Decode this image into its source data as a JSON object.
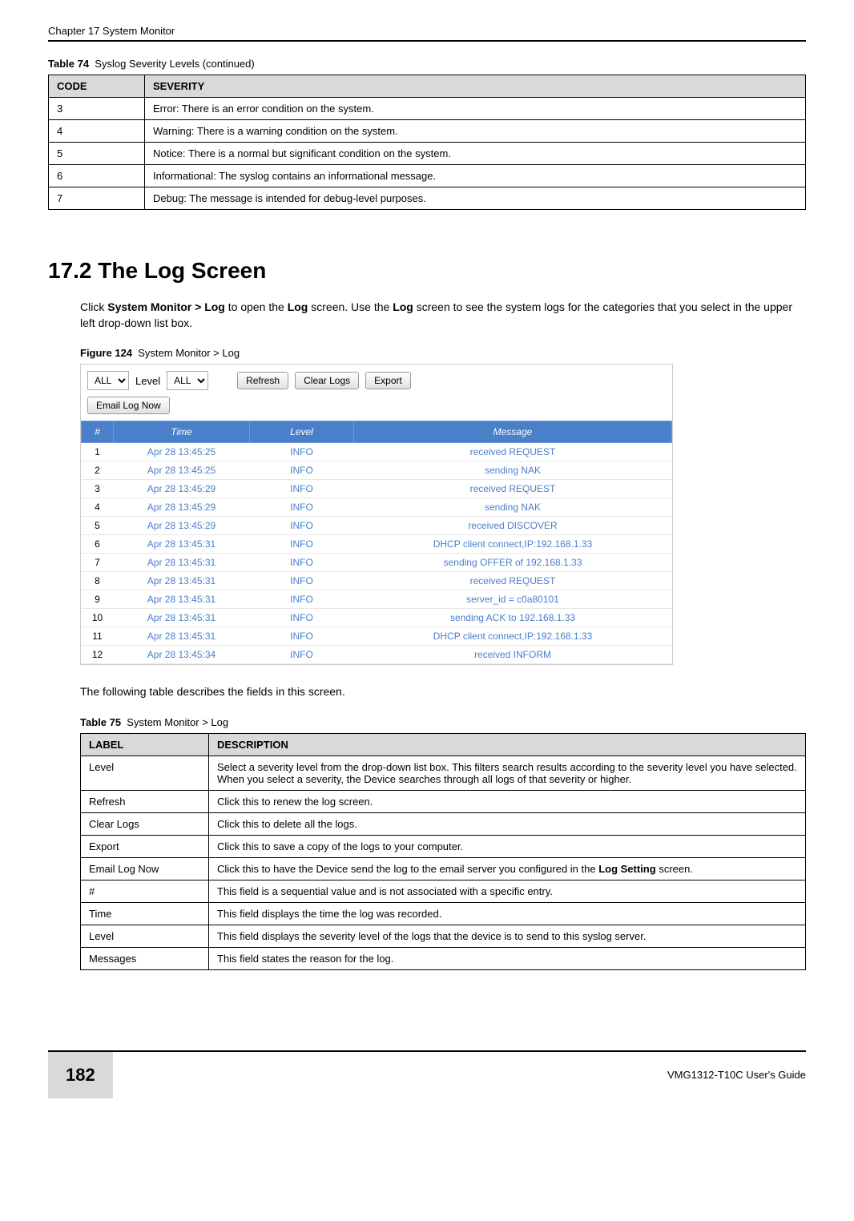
{
  "header": {
    "chapter": "Chapter 17 System Monitor"
  },
  "table74": {
    "title_label": "Table 74",
    "title": "Syslog Severity Levels (continued)",
    "headers": {
      "code": "CODE",
      "severity": "SEVERITY"
    },
    "rows": [
      {
        "code": "3",
        "severity": "Error: There is an error condition on the system."
      },
      {
        "code": "4",
        "severity": "Warning: There is a warning condition on the system."
      },
      {
        "code": "5",
        "severity": "Notice: There is a normal but significant condition on the system."
      },
      {
        "code": "6",
        "severity": "Informational: The syslog contains an informational message."
      },
      {
        "code": "7",
        "severity": "Debug: The message is intended for debug-level purposes."
      }
    ]
  },
  "section": {
    "heading": "17.2  The Log Screen",
    "intro_pre": "Click ",
    "intro_b1": "System Monitor > Log",
    "intro_mid1": " to open the ",
    "intro_b2": "Log",
    "intro_mid2": " screen. Use the ",
    "intro_b3": "Log",
    "intro_end": " screen to see the system logs for the categories that you select in the upper left drop-down list box."
  },
  "figure": {
    "label": "Figure 124",
    "title": "System Monitor > Log",
    "toolbar": {
      "category_select": "ALL",
      "level_label": "Level",
      "level_select": "ALL",
      "refresh_btn": "Refresh",
      "clear_btn": "Clear Logs",
      "export_btn": "Export",
      "email_btn": "Email Log Now"
    },
    "log_headers": {
      "num": "#",
      "time": "Time",
      "level": "Level",
      "message": "Message"
    },
    "log_rows": [
      {
        "num": "1",
        "time": "Apr 28 13:45:25",
        "level": "INFO",
        "message": "received REQUEST"
      },
      {
        "num": "2",
        "time": "Apr 28 13:45:25",
        "level": "INFO",
        "message": "sending NAK"
      },
      {
        "num": "3",
        "time": "Apr 28 13:45:29",
        "level": "INFO",
        "message": "received REQUEST"
      },
      {
        "num": "4",
        "time": "Apr 28 13:45:29",
        "level": "INFO",
        "message": "sending NAK"
      },
      {
        "num": "5",
        "time": "Apr 28 13:45:29",
        "level": "INFO",
        "message": "received DISCOVER"
      },
      {
        "num": "6",
        "time": "Apr 28 13:45:31",
        "level": "INFO",
        "message": "DHCP client connect,IP:192.168.1.33"
      },
      {
        "num": "7",
        "time": "Apr 28 13:45:31",
        "level": "INFO",
        "message": "sending OFFER of 192.168.1.33"
      },
      {
        "num": "8",
        "time": "Apr 28 13:45:31",
        "level": "INFO",
        "message": "received REQUEST"
      },
      {
        "num": "9",
        "time": "Apr 28 13:45:31",
        "level": "INFO",
        "message": "server_id = c0a80101"
      },
      {
        "num": "10",
        "time": "Apr 28 13:45:31",
        "level": "INFO",
        "message": "sending ACK to 192.168.1.33"
      },
      {
        "num": "11",
        "time": "Apr 28 13:45:31",
        "level": "INFO",
        "message": "DHCP client connect,IP:192.168.1.33"
      },
      {
        "num": "12",
        "time": "Apr 28 13:45:34",
        "level": "INFO",
        "message": "received INFORM"
      }
    ]
  },
  "table75_intro": "The following table describes the fields in this screen.",
  "table75": {
    "title_label": "Table 75",
    "title": "System Monitor > Log",
    "headers": {
      "label": "LABEL",
      "description": "DESCRIPTION"
    },
    "rows": [
      {
        "label": "Level",
        "description": "Select a severity level from the drop-down list box. This filters search results according to the severity level you have selected. When you select a severity, the Device searches through all logs of that severity or higher."
      },
      {
        "label": "Refresh",
        "description": "Click this to renew the log screen."
      },
      {
        "label": "Clear Logs",
        "description": "Click this to delete all the logs."
      },
      {
        "label": "Export",
        "description": "Click this to save a copy of the logs to your computer."
      },
      {
        "label": "Email Log Now",
        "description_pre": "Click this to have the Device send the log to the email server you configured in the ",
        "description_bold": "Log Setting",
        "description_post": " screen."
      },
      {
        "label": "#",
        "description": "This field is a sequential value and is not associated with a specific entry."
      },
      {
        "label": "Time",
        "description": "This field displays the time the log was recorded."
      },
      {
        "label": "Level",
        "description": "This field displays the severity level of the logs that the device is to send to this syslog server."
      },
      {
        "label": "Messages",
        "description": "This field states the reason for the log."
      }
    ]
  },
  "footer": {
    "page_num": "182",
    "guide": "VMG1312-T10C User's Guide"
  }
}
